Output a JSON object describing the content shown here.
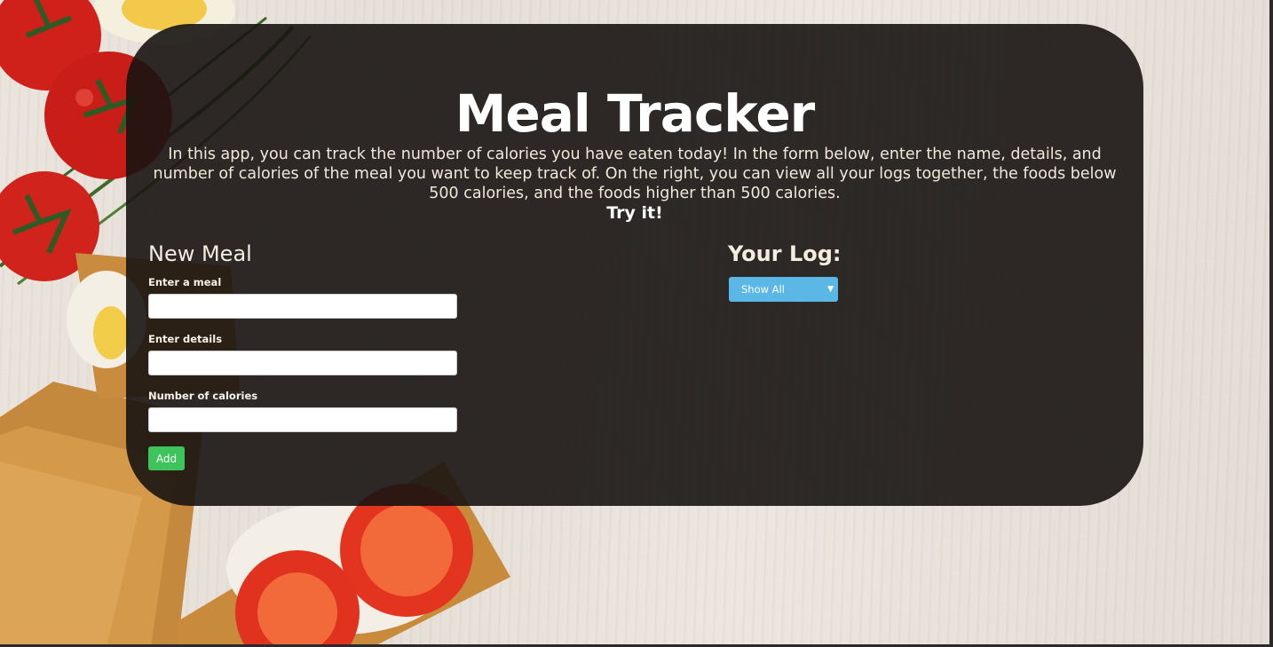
{
  "app": {
    "title": "Meal Tracker",
    "intro": "In this app, you can track the number of calories you have eaten today! In the form below, enter the name, details, and number of calories of the meal you want to keep track of. On the right, you can view all your logs together, the foods below 500 calories, and the foods higher than 500 calories.",
    "cta": "Try it!"
  },
  "form": {
    "title": "New Meal",
    "meal_label": "Enter a meal",
    "meal_value": "",
    "details_label": "Enter details",
    "details_value": "",
    "calories_label": "Number of calories",
    "calories_value": "",
    "add_label": "Add"
  },
  "log": {
    "title": "Your Log:",
    "filter_selected": "Show All"
  },
  "colors": {
    "panel_bg": "#181412",
    "add_button": "#3dc45c",
    "filter_select": "#5bb8e6"
  },
  "icons": {
    "filter_arrow": "chevron-down-icon"
  }
}
